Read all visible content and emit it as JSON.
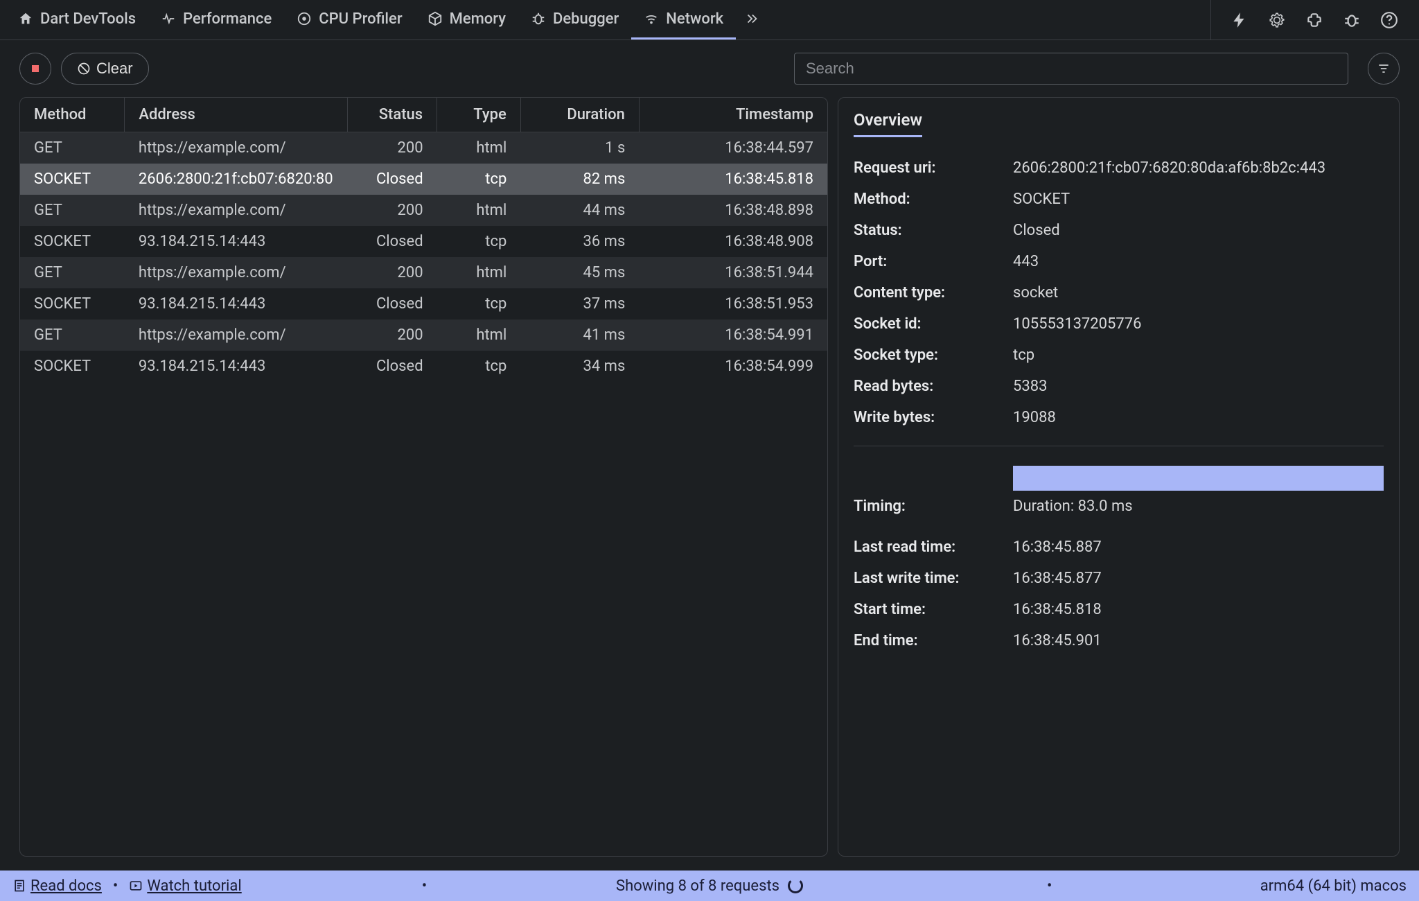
{
  "header": {
    "tabs": [
      {
        "label": "Dart DevTools",
        "icon": "home-icon"
      },
      {
        "label": "Performance",
        "icon": "pulse-icon"
      },
      {
        "label": "CPU Profiler",
        "icon": "target-icon"
      },
      {
        "label": "Memory",
        "icon": "cube-icon"
      },
      {
        "label": "Debugger",
        "icon": "bug-icon"
      },
      {
        "label": "Network",
        "icon": "wifi-icon",
        "active": true
      }
    ]
  },
  "toolbar": {
    "clear_label": "Clear",
    "search_placeholder": "Search"
  },
  "table": {
    "columns": [
      "Method",
      "Address",
      "Status",
      "Type",
      "Duration",
      "Timestamp"
    ],
    "rows": [
      {
        "method": "GET",
        "address": "https://example.com/",
        "status": "200",
        "type": "html",
        "duration": "1 s",
        "timestamp": "16:38:44.597"
      },
      {
        "method": "SOCKET",
        "address": "2606:2800:21f:cb07:6820:80",
        "status": "Closed",
        "type": "tcp",
        "duration": "82 ms",
        "timestamp": "16:38:45.818",
        "selected": true
      },
      {
        "method": "GET",
        "address": "https://example.com/",
        "status": "200",
        "type": "html",
        "duration": "44 ms",
        "timestamp": "16:38:48.898"
      },
      {
        "method": "SOCKET",
        "address": "93.184.215.14:443",
        "status": "Closed",
        "type": "tcp",
        "duration": "36 ms",
        "timestamp": "16:38:48.908"
      },
      {
        "method": "GET",
        "address": "https://example.com/",
        "status": "200",
        "type": "html",
        "duration": "45 ms",
        "timestamp": "16:38:51.944"
      },
      {
        "method": "SOCKET",
        "address": "93.184.215.14:443",
        "status": "Closed",
        "type": "tcp",
        "duration": "37 ms",
        "timestamp": "16:38:51.953"
      },
      {
        "method": "GET",
        "address": "https://example.com/",
        "status": "200",
        "type": "html",
        "duration": "41 ms",
        "timestamp": "16:38:54.991"
      },
      {
        "method": "SOCKET",
        "address": "93.184.215.14:443",
        "status": "Closed",
        "type": "tcp",
        "duration": "34 ms",
        "timestamp": "16:38:54.999"
      }
    ]
  },
  "details": {
    "tab_label": "Overview",
    "fields": {
      "request_uri_label": "Request uri:",
      "request_uri": "2606:2800:21f:cb07:6820:80da:af6b:8b2c:443",
      "method_label": "Method:",
      "method": "SOCKET",
      "status_label": "Status:",
      "status": "Closed",
      "port_label": "Port:",
      "port": "443",
      "content_type_label": "Content type:",
      "content_type": "socket",
      "socket_id_label": "Socket id:",
      "socket_id": "105553137205776",
      "socket_type_label": "Socket type:",
      "socket_type": "tcp",
      "read_bytes_label": "Read bytes:",
      "read_bytes": "5383",
      "write_bytes_label": "Write bytes:",
      "write_bytes": "19088",
      "timing_label": "Timing:",
      "duration_text": "Duration: 83.0 ms",
      "last_read_time_label": "Last read time:",
      "last_read_time": "16:38:45.887",
      "last_write_time_label": "Last write time:",
      "last_write_time": "16:38:45.877",
      "start_time_label": "Start time:",
      "start_time": "16:38:45.818",
      "end_time_label": "End time:",
      "end_time": "16:38:45.901"
    }
  },
  "statusbar": {
    "read_docs": "Read docs",
    "watch_tutorial": "Watch tutorial",
    "center": "Showing 8 of 8 requests",
    "right": "arm64 (64 bit) macos"
  }
}
